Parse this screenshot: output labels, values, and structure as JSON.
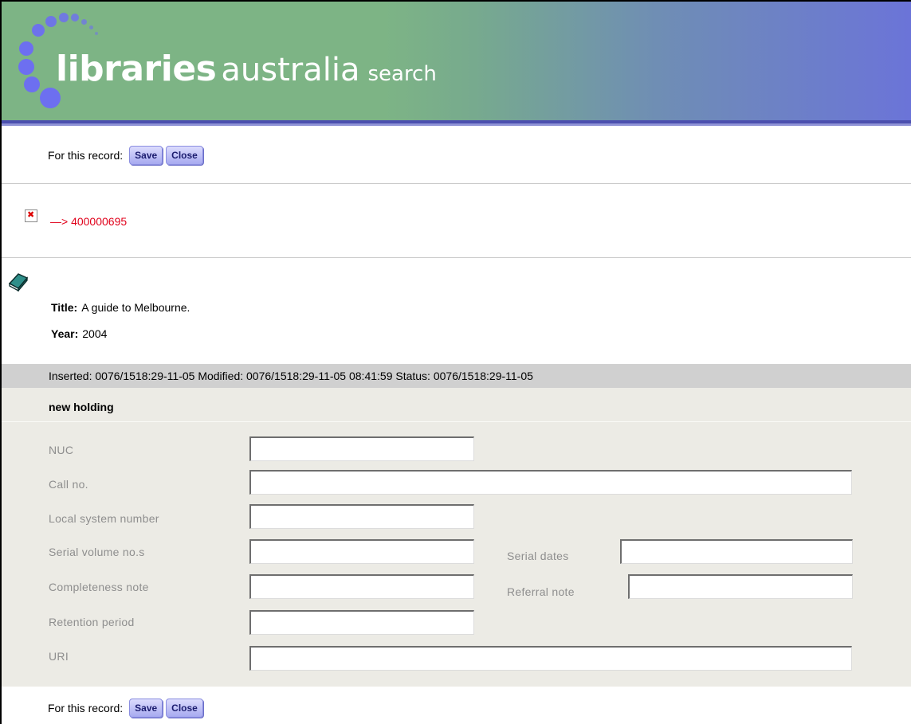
{
  "header": {
    "brand_main": "libraries",
    "brand_country": "australia",
    "brand_sub": "search"
  },
  "record_actions": {
    "label": "For this record:",
    "save": "Save",
    "close": "Close"
  },
  "record_link": {
    "text": "—> 400000695"
  },
  "record": {
    "title_label": "Title:",
    "title": "A guide to Melbourne.",
    "year_label": "Year:",
    "year": "2004"
  },
  "status_line": "Inserted: 0076/1518:29-11-05 Modified: 0076/1518:29-11-05 08:41:59 Status: 0076/1518:29-11-05",
  "holding": {
    "heading": "new holding",
    "nuc": {
      "label": "NUC",
      "value": ""
    },
    "call_no": {
      "label": "Call no.",
      "value": ""
    },
    "local_system_number": {
      "label": "Local system number",
      "value": ""
    },
    "serial_volume": {
      "label": "Serial volume no.s",
      "value": ""
    },
    "serial_dates": {
      "label": "Serial dates",
      "value": ""
    },
    "completeness_note": {
      "label": "Completeness note",
      "value": ""
    },
    "referral_note": {
      "label": "Referral note",
      "value": ""
    },
    "retention_period": {
      "label": "Retention period",
      "value": ""
    },
    "uri": {
      "label": "URI",
      "value": ""
    }
  },
  "colors": {
    "banner_green": "#7db485",
    "banner_blue": "#6b74d8",
    "link_red": "#e0001a",
    "button_fill": "#a7aaf0"
  }
}
